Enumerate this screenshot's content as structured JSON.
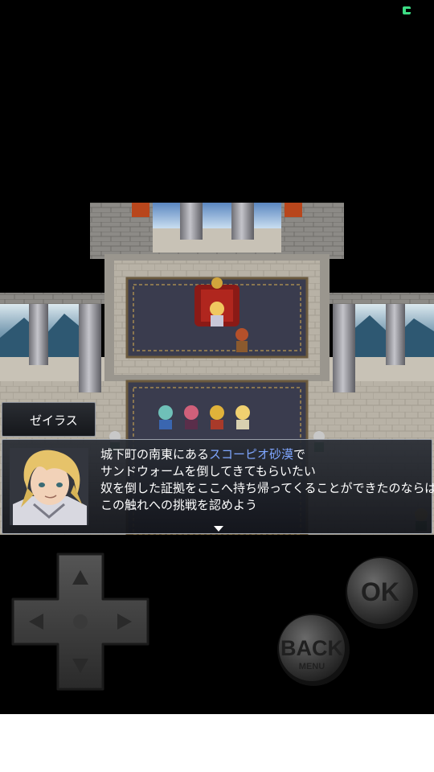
{
  "status": {
    "icon": "battery-icon",
    "color": "#3ddc84"
  },
  "dialog": {
    "speaker": "ゼイラス",
    "lines": [
      {
        "pre": "城下町の南東にある",
        "highlight": "スコーピオ砂漠",
        "post": "で"
      },
      {
        "text": "サンドウォームを倒してきてもらいたい"
      },
      {
        "text": "奴を倒した証拠をここへ持ち帰ってくることができたのならば、"
      },
      {
        "text": "この触れへの挑戦を認めよう"
      }
    ],
    "highlight_color": "#7fa6ff"
  },
  "controls": {
    "ok_label": "OK",
    "back_label": "BACK",
    "menu_label": "MENU"
  }
}
